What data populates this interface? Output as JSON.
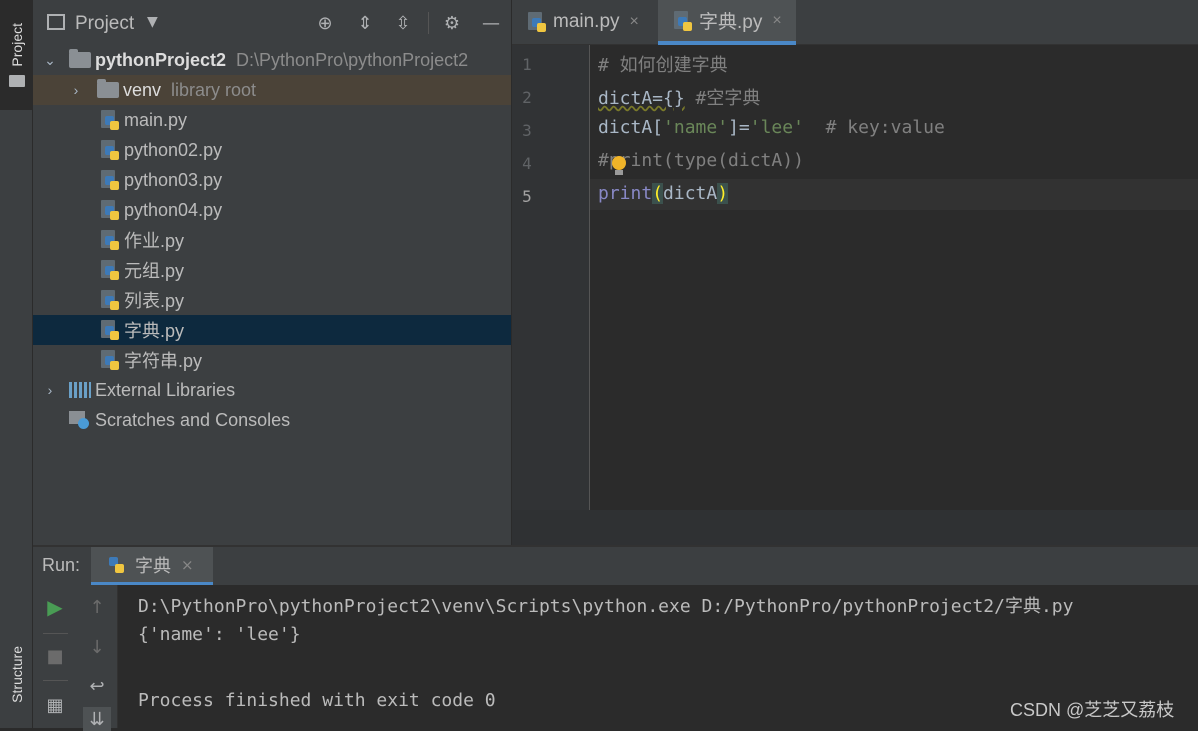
{
  "left_stripe": {
    "project_tab": "Project",
    "structure_tab": "Structure"
  },
  "project_panel": {
    "title": "Project",
    "tree": [
      {
        "label": "pythonProject2",
        "path": "D:\\PythonPro\\pythonProject2"
      },
      {
        "label": "venv",
        "note": "library root"
      },
      {
        "label": "main.py"
      },
      {
        "label": "python02.py"
      },
      {
        "label": "python03.py"
      },
      {
        "label": "python04.py"
      },
      {
        "label": "作业.py"
      },
      {
        "label": "元组.py"
      },
      {
        "label": "列表.py"
      },
      {
        "label": "字典.py"
      },
      {
        "label": "字符串.py"
      },
      {
        "label": "External Libraries"
      },
      {
        "label": "Scratches and Consoles"
      }
    ]
  },
  "editor": {
    "tabs": [
      {
        "label": "main.py",
        "close": "×"
      },
      {
        "label": "字典.py",
        "close": "×"
      }
    ],
    "line_numbers": [
      "1",
      "2",
      "3",
      "4",
      "5"
    ],
    "lines": [
      {
        "comment": "# 如何创建字典"
      },
      {
        "code": "dictA={}",
        "comment": " #空字典"
      },
      {
        "var": "dictA[",
        "str1": "'name'",
        "mid": "]=",
        "str2": "'lee'",
        "comment": "  # key:value"
      },
      {
        "comment_a": "#",
        "comment_b": "print(type(dictA))"
      },
      {
        "func": "print",
        "open": "(",
        "arg": "dictA",
        "close": ")"
      }
    ]
  },
  "run_panel": {
    "label": "Run:",
    "tab": "字典",
    "close": "×",
    "output": [
      "D:\\PythonPro\\pythonProject2\\venv\\Scripts\\python.exe D:/PythonPro/pythonProject2/字典.py",
      "{'name': 'lee'}",
      "",
      "Process finished with exit code 0"
    ]
  },
  "watermark": "CSDN @芝芝又荔枝",
  "colors": {
    "selected_row": "#0d293e",
    "venv_row": "#4b4338",
    "active_tab": "#4e5254",
    "tab_underline": "#4a88c7",
    "run_green": "#499c54"
  }
}
